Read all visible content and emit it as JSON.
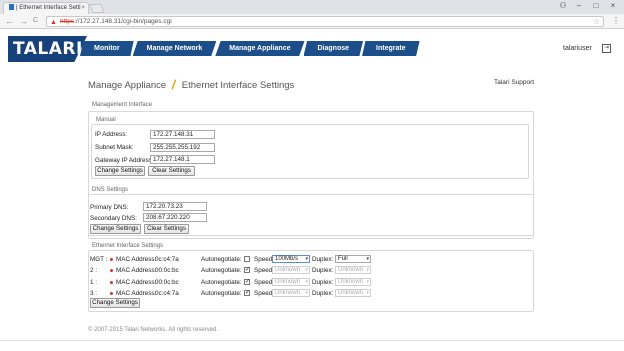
{
  "browser": {
    "tab_title": "| Ethernet Interface Setti",
    "tab_close": "×",
    "url_scheme": "https",
    "url_rest": "://172.27.148.31/cgi-bin/pages.cgi",
    "back": "←",
    "forward": "→",
    "reload": "C",
    "warn_icon": "▲",
    "star_icon": "☆",
    "menu_icon": "⋮",
    "win_user": "⚇",
    "win_min": "–",
    "win_max": "□",
    "win_close": "×"
  },
  "app": {
    "logo": "TALARI",
    "nav": [
      "Monitor",
      "Manage Network",
      "Manage Appliance",
      "Diagnose",
      "Integrate"
    ],
    "user": "talariuser",
    "logout_icon": "⇥"
  },
  "page": {
    "title_left": "Manage Appliance",
    "title_sep": "/",
    "title_right": "Ethernet Interface Settings",
    "support": "Talari Support"
  },
  "mgmt": {
    "title": "Management Interface",
    "manual": {
      "title": "Manual",
      "ip_label": "IP Address:",
      "ip_value": "172.27.148.31",
      "mask_label": "Subnet Mask:",
      "mask_value": "255.255.255.192",
      "gw_label": "Gateway IP Address:",
      "gw_value": "172.27.148.1",
      "change_btn": "Change Settings",
      "clear_btn": "Clear Settings"
    },
    "dns": {
      "title": "DNS Settings",
      "primary_label": "Primary DNS:",
      "primary_value": "172.20.73.23",
      "secondary_label": "Secondary DNS:",
      "secondary_value": "208.67.220.220",
      "change_btn": "Change Settings",
      "clear_btn": "Clear Settings"
    }
  },
  "eth": {
    "title": "Ethernet Interface Settings",
    "mac_label": "MAC Address:",
    "auto_label": "Autonegotiate:",
    "speed_label": "Speed:",
    "duplex_label": "Duplex:",
    "check_mark": "✓",
    "select_arrow": "▾",
    "rows": [
      {
        "port": "MGT :",
        "mac": "0c:c4:7a",
        "auto": false,
        "speed": "100Mb/s",
        "duplex": "Full"
      },
      {
        "port": "2 :",
        "mac": "00:0c:bc",
        "auto": true,
        "speed": "Unknown",
        "duplex": "Unknown"
      },
      {
        "port": "1 :",
        "mac": "00:0c:bc",
        "auto": true,
        "speed": "Unknown",
        "duplex": "Unknown"
      },
      {
        "port": "3 :",
        "mac": "0c:c4:7a",
        "auto": true,
        "speed": "Unknown",
        "duplex": "Unknown"
      }
    ],
    "change_btn": "Change Settings"
  },
  "footer": "© 2007-2015 Talari Networks. All rights reserved."
}
